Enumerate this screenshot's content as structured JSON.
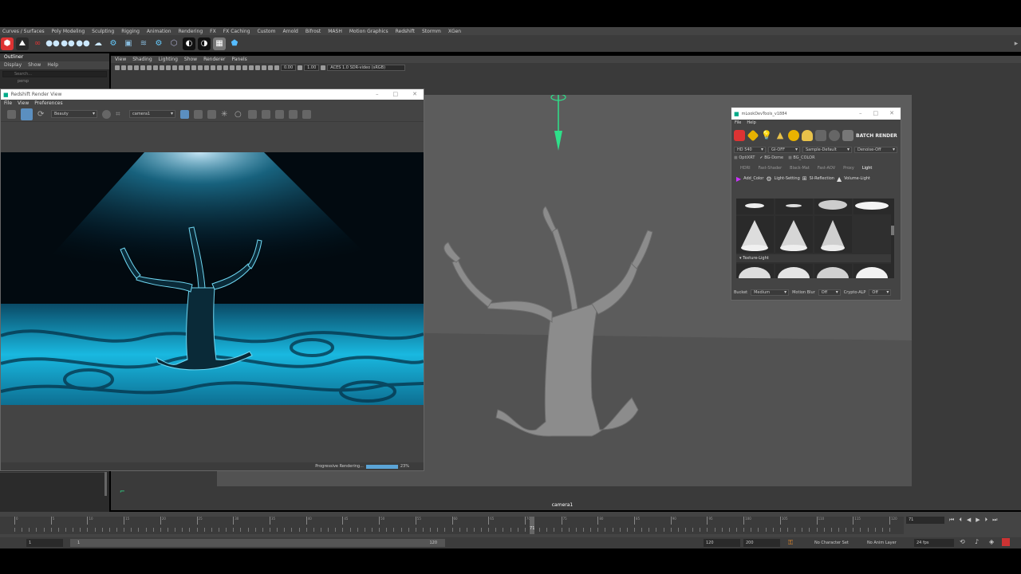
{
  "menubar": [
    "Curves / Surfaces",
    "Poly Modeling",
    "Sculpting",
    "Rigging",
    "Animation",
    "Rendering",
    "FX",
    "FX Caching",
    "Custom",
    "Arnold",
    "Bifrost",
    "MASH",
    "Motion Graphics",
    "Redshift",
    "Stormm",
    "XGen"
  ],
  "outliner": {
    "title": "Outliner",
    "menu": [
      "Display",
      "Show",
      "Help"
    ],
    "search_placeholder": "Search...",
    "first_item": "persp"
  },
  "viewport": {
    "menu": [
      "View",
      "Shading",
      "Lighting",
      "Show",
      "Renderer",
      "Panels"
    ],
    "field_a": "0.00",
    "field_b": "1.00",
    "color_space": "ACES 1.0 SDR-video (sRGB)",
    "camera_label": "camera1"
  },
  "redshift": {
    "title": "Redshift Render View",
    "menu": [
      "File",
      "View",
      "Preferences"
    ],
    "aov": "Beauty",
    "camera": "camera1",
    "status": "Progressive Rendering...",
    "progress_label": "23%",
    "progress": 0.23
  },
  "lookdev": {
    "title": "mLookDevTools_v1884",
    "menu": [
      "File",
      "Help"
    ],
    "batch_render": "BATCH RENDER",
    "res": "HD 540",
    "gi": "GI-OFF",
    "sample": "Sample-Default",
    "denoise": "Denoise-Off",
    "checks": [
      {
        "label": "OptiXRT",
        "checked": false
      },
      {
        "label": "BG-Dome",
        "checked": true
      },
      {
        "label": "BG_COLOR",
        "checked": false
      }
    ],
    "tabs": [
      "HDRI",
      "Fast-Shader",
      "Black-Mat",
      "Fast-AOV",
      "Proxy",
      "Light"
    ],
    "active_tab": "Light",
    "actions": [
      "Add_Color",
      "Light-Setting",
      "SI-Reflection",
      "Volume-Light"
    ],
    "section": "Texture-Light",
    "bucket_label": "Bucket",
    "bucket": "Medium",
    "motion_blur_label": "Motion Blur",
    "motion_blur": "Off",
    "crypto_label": "Crypto-ALP",
    "crypto": "Off"
  },
  "timeline": {
    "ticks": [
      "0",
      "5",
      "10",
      "15",
      "20",
      "25",
      "30",
      "35",
      "40",
      "45",
      "50",
      "55",
      "60",
      "65",
      "70",
      "75",
      "80",
      "85",
      "90",
      "95",
      "100",
      "105",
      "110",
      "115",
      "120"
    ],
    "current_frame": "71",
    "current_frame_field": "71"
  },
  "range": {
    "start": "1",
    "inner_start": "1",
    "inner_end": "120",
    "anim_end": "120",
    "end": "200",
    "char_set": "No Character Set",
    "anim_layer": "No Anim Layer",
    "fps": "24 fps"
  },
  "colors": {
    "render_cyan": "#19b8e0",
    "maya_panel": "#444444",
    "viewport_gray": "#5c5c5c",
    "progress_blue": "#5ba4d6"
  }
}
